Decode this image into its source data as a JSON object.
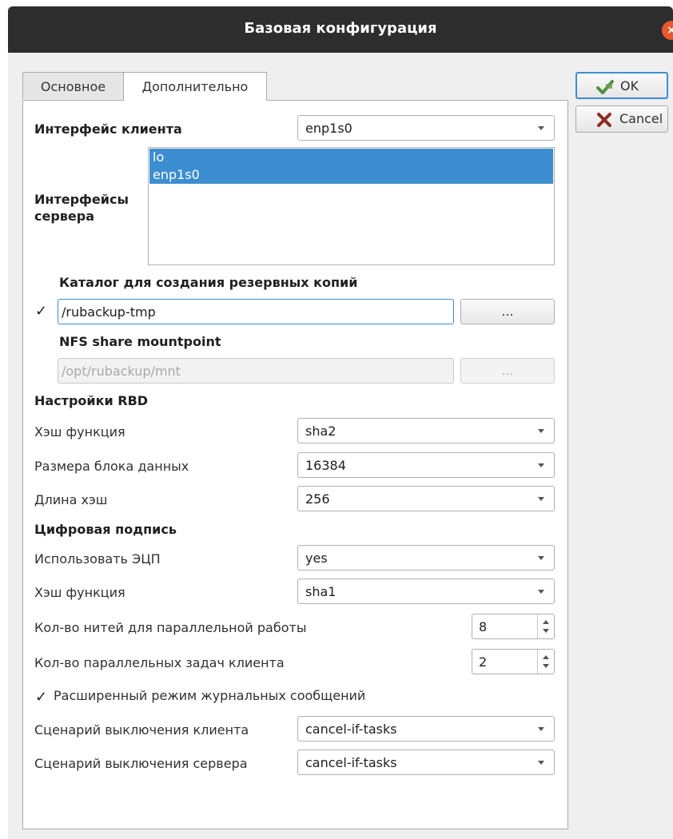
{
  "window": {
    "title": "Базовая конфигурация",
    "close_icon": "×"
  },
  "tabs": [
    {
      "label": "Основное",
      "active": false
    },
    {
      "label": "Дополнительно",
      "active": true
    }
  ],
  "buttons": {
    "ok_label": "OK",
    "cancel_label": "Cancel"
  },
  "client_interface": {
    "label": "Интерфейс клиента",
    "value": "enp1s0"
  },
  "server_interfaces": {
    "label_line1": "Интерфейсы",
    "label_line2": "сервера",
    "items": [
      "lo",
      "enp1s0"
    ]
  },
  "backup_dir": {
    "label": "Каталог для создания резервных копий",
    "checked": "✓",
    "value": "/rubackup-tmp",
    "browse_label": "..."
  },
  "nfs": {
    "label": "NFS share mountpoint",
    "value": "/opt/rubackup/mnt",
    "browse_label": "..."
  },
  "rbd": {
    "section": "Настройки RBD",
    "hash_label": "Хэш функция",
    "hash_value": "sha2",
    "block_label": "Размера блока данных",
    "block_value": "16384",
    "length_label": "Длина хэш",
    "length_value": "256"
  },
  "signature": {
    "section": "Цифровая подпись",
    "use_label": "Использовать ЭЦП",
    "use_value": "yes",
    "hash_label": "Хэш функция",
    "hash_value": "sha1"
  },
  "threads": {
    "label": "Кол-во нитей для параллельной работы",
    "value": "8"
  },
  "tasks": {
    "label": "Кол-во параллельных задач клиента",
    "value": "2"
  },
  "extended_log": {
    "checked": "✓",
    "label": "Расширенный режим журнальных сообщений"
  },
  "shutdown_client": {
    "label": "Сценарий выключения клиента",
    "value": "cancel-if-tasks"
  },
  "shutdown_server": {
    "label": "Сценарий выключения сервера",
    "value": "cancel-if-tasks"
  }
}
